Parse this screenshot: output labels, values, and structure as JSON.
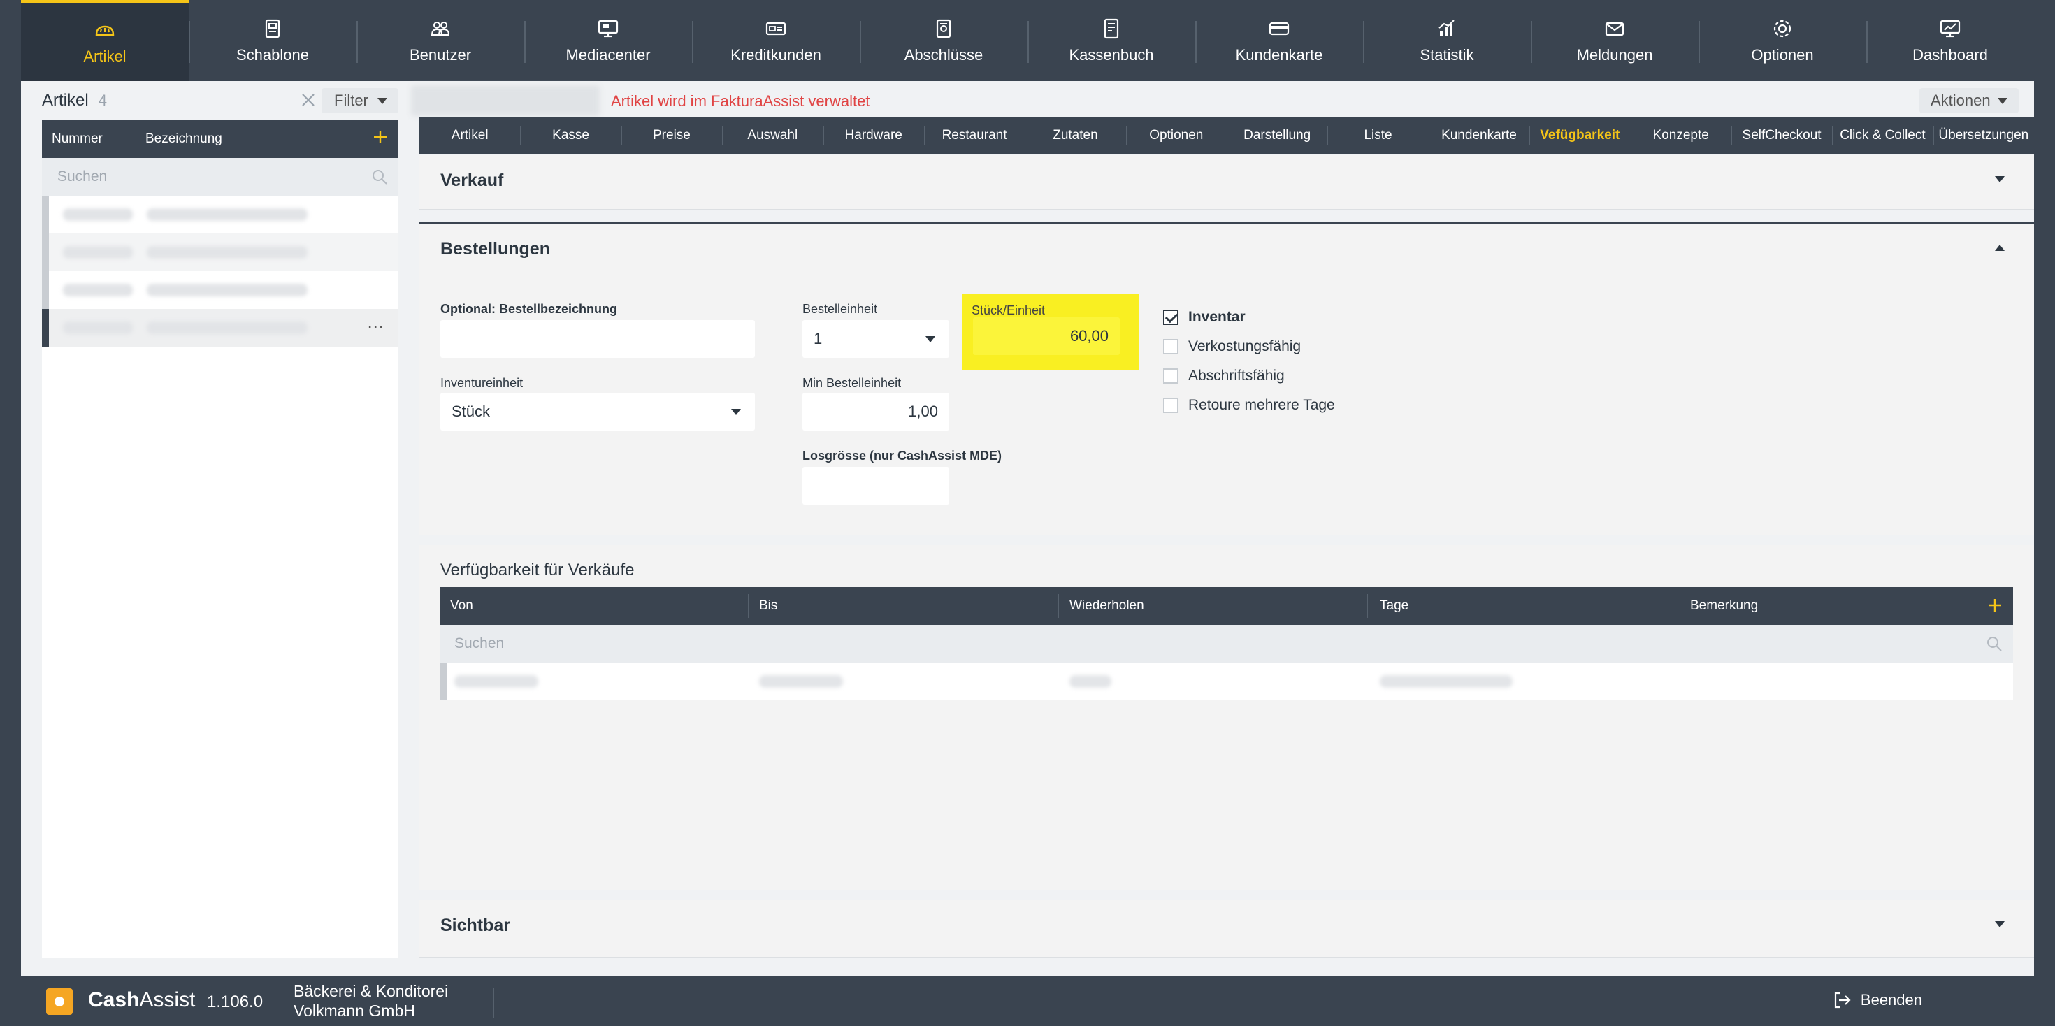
{
  "nav": [
    {
      "label": "Artikel",
      "icon": "bread-icon",
      "active": true
    },
    {
      "label": "Schablone",
      "icon": "template-icon"
    },
    {
      "label": "Benutzer",
      "icon": "users-icon"
    },
    {
      "label": "Mediacenter",
      "icon": "monitor-icon"
    },
    {
      "label": "Kreditkunden",
      "icon": "credit-card-icon"
    },
    {
      "label": "Abschlüsse",
      "icon": "document-icon"
    },
    {
      "label": "Kassenbuch",
      "icon": "book-icon"
    },
    {
      "label": "Kundenkarte",
      "icon": "card-icon"
    },
    {
      "label": "Statistik",
      "icon": "chart-icon"
    },
    {
      "label": "Meldungen",
      "icon": "mail-icon"
    },
    {
      "label": "Optionen",
      "icon": "gear-icon"
    },
    {
      "label": "Dashboard",
      "icon": "dashboard-icon"
    }
  ],
  "left": {
    "title": "Artikel",
    "count": "4",
    "filter_label": "Filter",
    "col_nummer": "Nummer",
    "col_bezeichnung": "Bezeichnung",
    "search_placeholder": "Suchen"
  },
  "right": {
    "managed_notice": "Artikel wird im FakturaAssist verwaltet",
    "actions_label": "Aktionen",
    "tabs": [
      "Artikel",
      "Kasse",
      "Preise",
      "Auswahl",
      "Hardware",
      "Restaurant",
      "Zutaten",
      "Optionen",
      "Darstellung",
      "Liste",
      "Kundenkarte",
      "Vefügbarkeit",
      "Konzepte",
      "SelfCheckout",
      "Click & Collect",
      "Übersetzungen"
    ],
    "active_tab": "Vefügbarkeit"
  },
  "verkauf": {
    "title": "Verkauf"
  },
  "bestellungen": {
    "title": "Bestellungen",
    "bestellbezeichnung_label": "Optional: Bestellbezeichnung",
    "bestellbezeichnung_value": "",
    "bestelleinheit_label": "Bestelleinheit",
    "bestelleinheit_value": "1",
    "stueck_label": "Stück/Einheit",
    "stueck_value": "60,00",
    "inventureinheit_label": "Inventureinheit",
    "inventureinheit_value": "Stück",
    "min_label": "Min Bestelleinheit",
    "min_value": "1,00",
    "los_label": "Losgrösse (nur CashAssist MDE)",
    "los_value": "",
    "checkboxes": [
      {
        "label": "Inventar",
        "checked": true
      },
      {
        "label": "Verkostungsfähig",
        "checked": false
      },
      {
        "label": "Abschriftsfähig",
        "checked": false
      },
      {
        "label": "Retoure mehrere Tage",
        "checked": false
      }
    ]
  },
  "verfuegbarkeit": {
    "title": "Verfügbarkeit für Verkäufe",
    "columns": [
      "Von",
      "Bis",
      "Wiederholen",
      "Tage",
      "Bemerkung"
    ],
    "search_placeholder": "Suchen"
  },
  "sichtbar": {
    "title": "Sichtbar"
  },
  "footer": {
    "brand_bold": "Cash",
    "brand_rest": "Assist",
    "version": "1.106.0",
    "company_line1": "Bäckerei & Konditorei",
    "company_line2": "Volkmann GmbH",
    "logout_label": "Beenden"
  },
  "colors": {
    "accent": "#f5c518",
    "header": "#3a4450",
    "highlight": "#f9ef22",
    "notice": "#e04444"
  }
}
